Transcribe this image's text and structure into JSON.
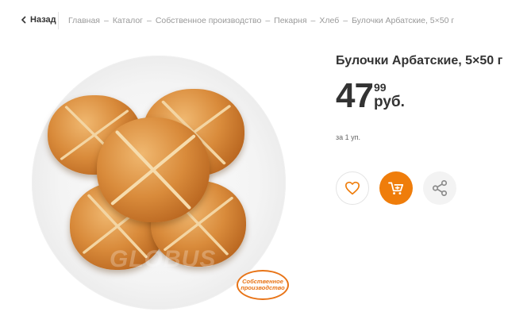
{
  "nav": {
    "back_label": "Назад",
    "breadcrumbs": [
      "Главная",
      "Каталог",
      "Собственное производство",
      "Пекарня",
      "Хлеб",
      "Булочки Арбатские, 5×50 г"
    ],
    "separator": "–"
  },
  "product": {
    "title": "Булочки Арбатские, 5×50 г",
    "price_rub": "47",
    "price_kop": "99",
    "currency": "руб.",
    "unit_note": "за 1 уп.",
    "badge_text_line1": "Собственное",
    "badge_text_line2": "производство",
    "watermark": "GLOBUS"
  },
  "actions": {
    "favorite_icon": "heart-icon",
    "cart_icon": "cart-icon",
    "share_icon": "share-icon"
  },
  "colors": {
    "accent": "#ef7d0b",
    "badge": "#e87417",
    "text": "#333333",
    "muted": "#9a9a9a"
  }
}
